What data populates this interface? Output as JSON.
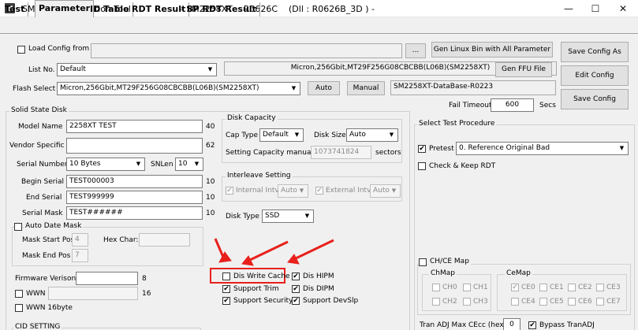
{
  "window": {
    "title": "SMI Mass Production Tool                  - SM2258XT    R0626C    (Dll : R0626B_3D ) -",
    "minimize": "—",
    "maximize": "☐",
    "close": "✕"
  },
  "tabs": [
    "Test",
    "Parameter",
    "ID Table",
    "RDT Result",
    "8P RDT Result"
  ],
  "top": {
    "load_config_label": "Load Config from",
    "load_config_value": "",
    "browse_btn": "...",
    "gen_linux_btn": "Gen Linux Bin with All Parameter",
    "save_config_as_btn": "Save Config As",
    "list_no_label": "List No.",
    "list_no_value": "Default",
    "flash_desc": "Micron,256Gbit,MT29F256G08CBCBB(L06B)(SM2258XT)",
    "gen_ffu_btn": "Gen FFU File",
    "edit_config_btn": "Edit Config",
    "flash_select_label": "Flash Select",
    "flash_select_value": "Micron,256Gbit,MT29F256G08CBCBB(L06B)(SM2258XT)",
    "auto_btn": "Auto",
    "manual_btn": "Manual",
    "database_value": "SM2258XT-DataBase-R0223",
    "save_config_btn": "Save Config",
    "fail_timeout_label": "Fail Timeout",
    "fail_timeout_value": "600",
    "secs_label": "Secs"
  },
  "ssd": {
    "group_title": "Solid State Disk",
    "model_name_label": "Model Name",
    "model_name_value": "2258XT TEST",
    "model_name_len": "40",
    "vendor_label": "Vendor Specific",
    "vendor_value": "",
    "vendor_len": "62",
    "serial_number_label": "Serial Number",
    "serial_number_value": "10 Bytes",
    "snlen_label": "SNLen",
    "snlen_value": "10",
    "begin_serial_label": "Begin Serial",
    "begin_serial_value": "TEST000003",
    "begin_serial_len": "10",
    "end_serial_label": "End Serial",
    "end_serial_value": "TEST999999",
    "end_serial_len": "10",
    "serial_mask_label": "Serial Mask",
    "serial_mask_value": "TEST######",
    "serial_mask_len": "10",
    "auto_date_mask_label": "Auto Date Mask",
    "mask_start_label": "Mask Start Pos",
    "mask_start_value": "4",
    "hex_char_label": "Hex Char:",
    "hex_char_value": "",
    "mask_end_label": "Mask End Pos",
    "mask_end_value": "7",
    "firmware_label": "Firmware Verison",
    "firmware_value": "",
    "firmware_len": "8",
    "wwn_label": "WWN",
    "wwn_value": "",
    "wwn_len": "16",
    "wwn16_label": "WWN 16byte",
    "cid_label": "CID SETTING"
  },
  "disk_capacity": {
    "group_title": "Disk Capacity",
    "cap_type_label": "Cap Type",
    "cap_type_value": "Default",
    "disk_size_label": "Disk Size",
    "disk_size_value": "Auto",
    "setting_capacity_label": "Setting Capacity manually",
    "setting_capacity_value": "1073741824",
    "sectors_label": "sectors"
  },
  "interleave": {
    "group_title": "Interleave Setting",
    "internal_label": "Internal Intv",
    "internal_value": "Auto",
    "external_label": "External Intv",
    "external_value": "Auto"
  },
  "disk_type": {
    "label": "Disk Type",
    "value": "SSD"
  },
  "options": {
    "dis_write_cache": "Dis Write Cache",
    "dis_hipm": "Dis HIPM",
    "support_trim": "Support Trim",
    "dis_dipm": "Dis DIPM",
    "support_security": "Support Security",
    "support_devslp": "Support DevSlp",
    "check": "✔"
  },
  "test_procedure": {
    "group_title": "Select Test Procedure",
    "pretest_label": "Pretest",
    "pretest_value": "0. Reference Original Bad",
    "check_keep_rdt_label": "Check & Keep RDT"
  },
  "ch_ce_map": {
    "label": "CH/CE Map",
    "chmap_title": "ChMap",
    "cemap_title": "CeMap",
    "ch": [
      "CH0",
      "CH1",
      "CH2",
      "CH3"
    ],
    "ce": [
      "CE0",
      "CE1",
      "CE2",
      "CE3",
      "CE4",
      "CE5",
      "CE6",
      "CE7"
    ]
  },
  "tran_adj": {
    "label": "Tran ADJ Max CEcc (hex)",
    "value": "0",
    "bypass_label": "Bypass TranADJ"
  },
  "colors": {
    "annotation": "#e8201c"
  }
}
